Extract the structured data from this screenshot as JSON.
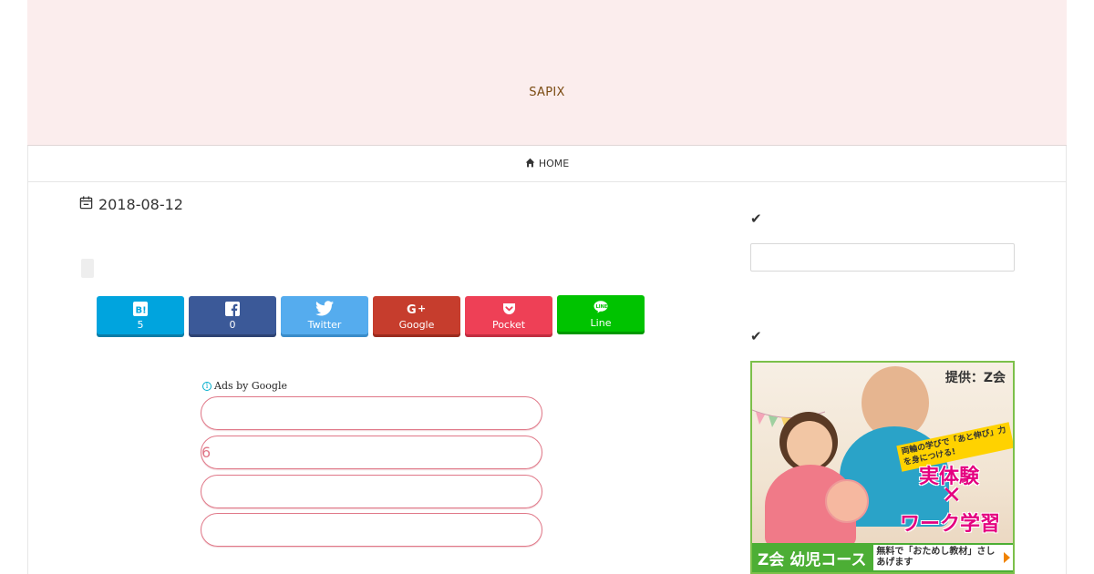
{
  "header": {
    "site_title": "SAPIX"
  },
  "nav": {
    "home_label": "HOME"
  },
  "article": {
    "date": "2018-08-12"
  },
  "share_buttons": [
    {
      "id": "hatena",
      "icon": "hatena-bookmark-icon",
      "label": "5",
      "color": "#00a4de"
    },
    {
      "id": "facebook",
      "icon": "facebook-icon",
      "label": "0",
      "color": "#3b5998"
    },
    {
      "id": "twitter",
      "icon": "twitter-icon",
      "label": "Twitter",
      "color": "#55acee"
    },
    {
      "id": "google",
      "icon": "google-plus-icon",
      "label": "Google",
      "color": "#c63d2d"
    },
    {
      "id": "pocket",
      "icon": "pocket-icon",
      "label": "Pocket",
      "color": "#ee4056"
    },
    {
      "id": "line",
      "icon": "line-icon",
      "label": "Line",
      "color": "#00c300"
    }
  ],
  "ads": {
    "label": "Ads by Google",
    "links": [
      "",
      "6",
      "",
      ""
    ]
  },
  "sidebar": {
    "widget1_icon": "checkmark-icon",
    "widget2_icon": "checkmark-icon",
    "banner": {
      "provider": "提供：Z会",
      "tagline": "両輪の学びで「あと伸び」力を身につける!",
      "headline_1": "実体験",
      "cross": "✕",
      "headline_2": "ワーク学習",
      "course": "Z会 幼児コース",
      "cta": "無料で「おためし教材」さしあげます"
    }
  }
}
